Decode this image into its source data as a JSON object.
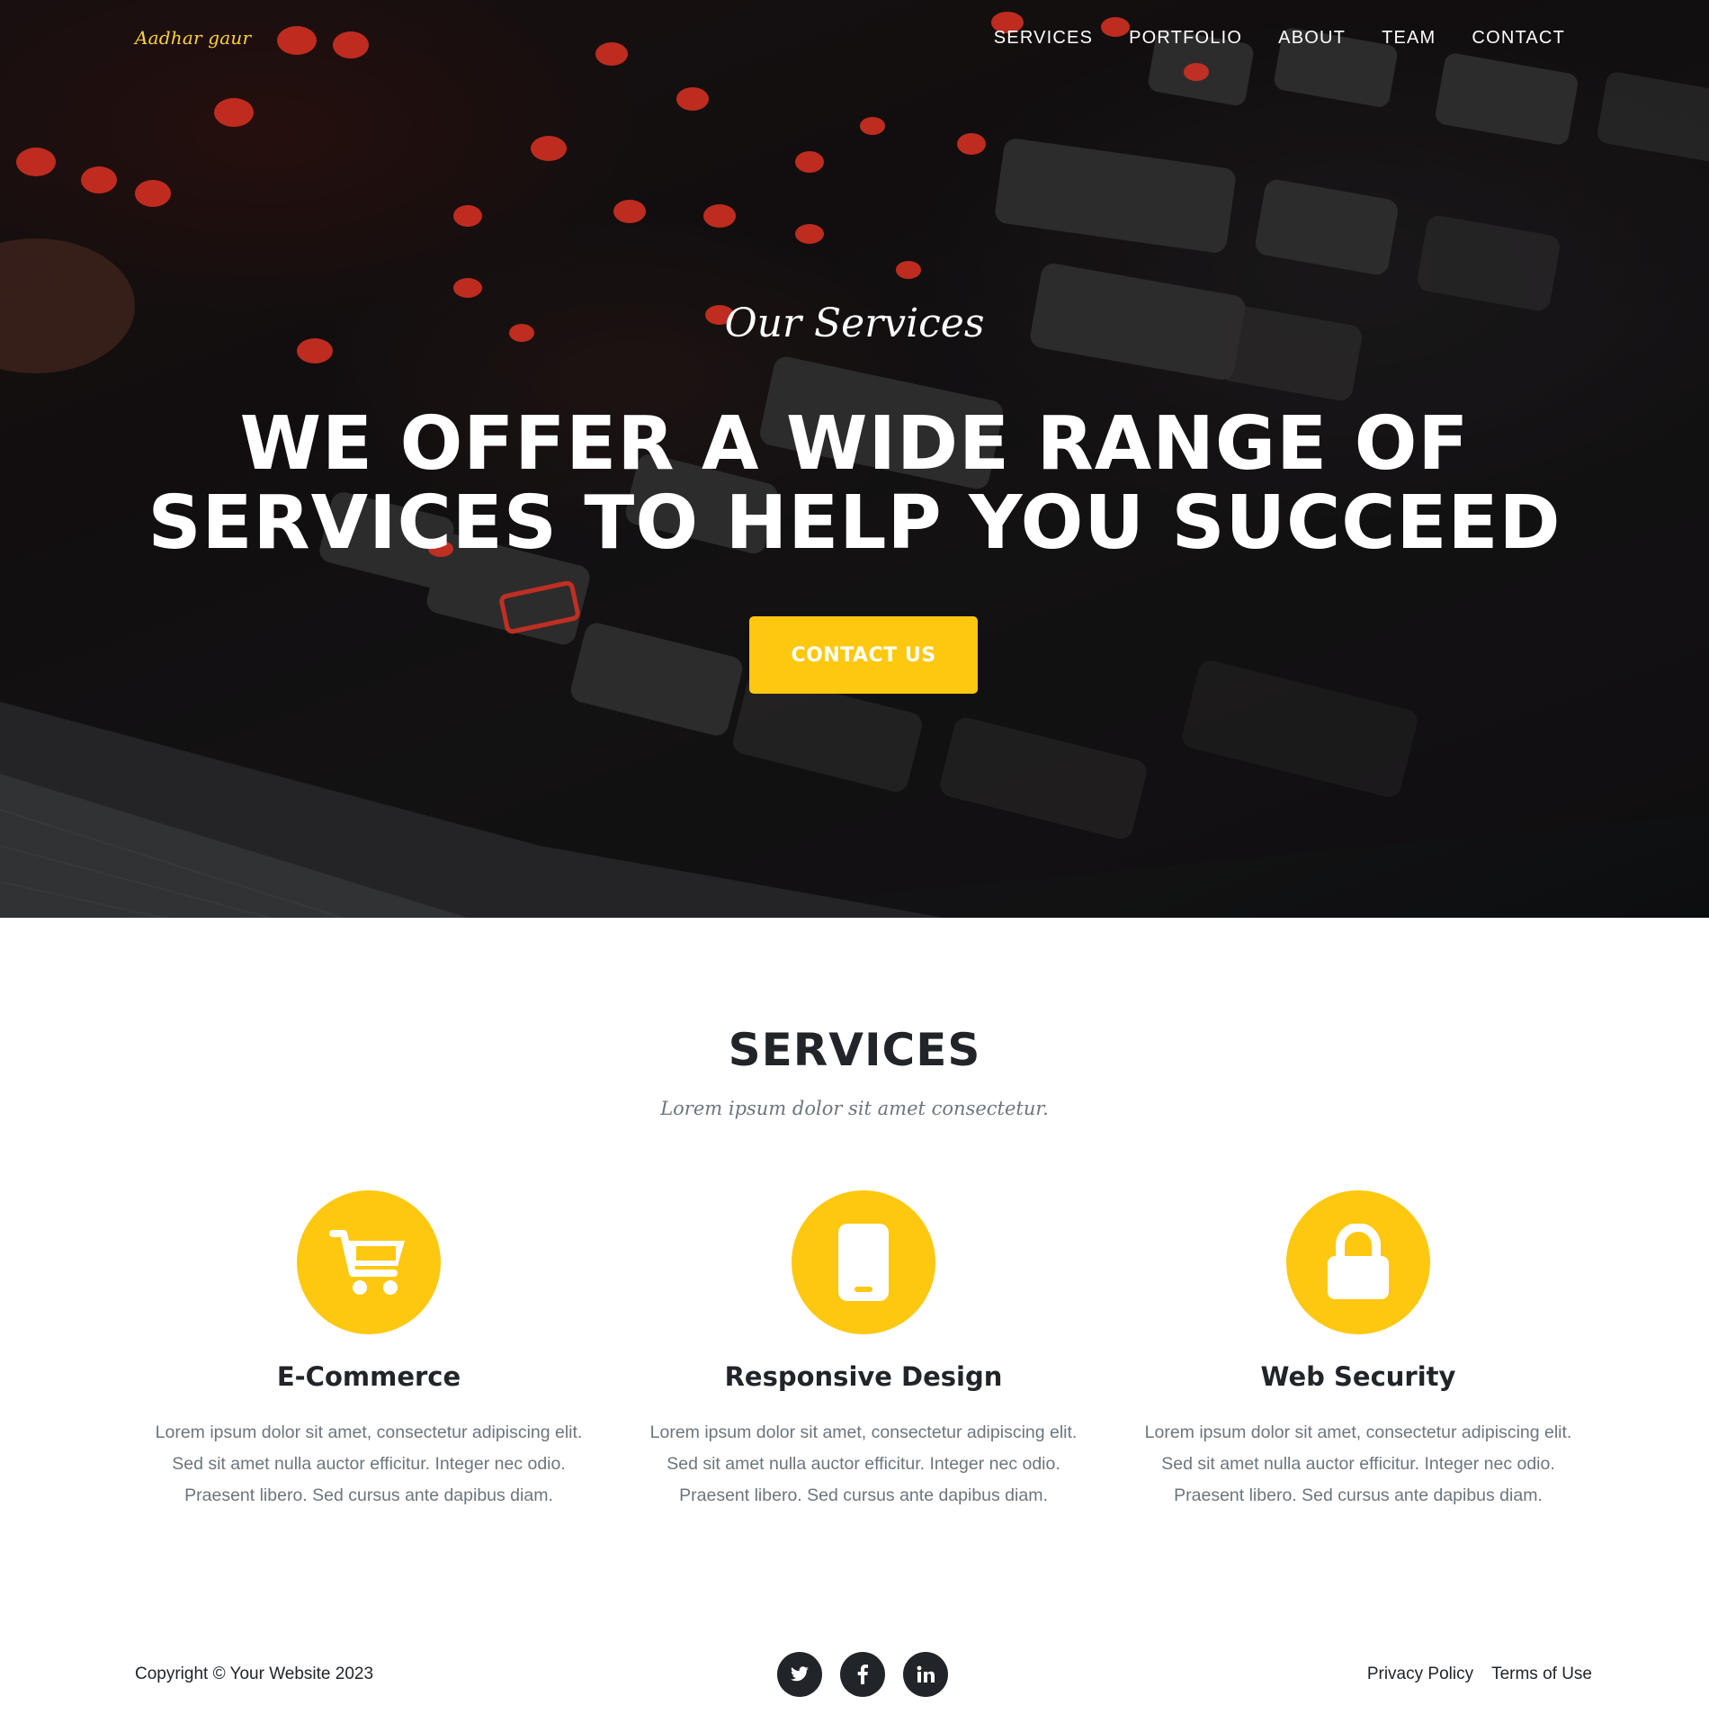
{
  "brand": {
    "name": "Aadhar gaur"
  },
  "nav": {
    "items": [
      {
        "label": "SERVICES"
      },
      {
        "label": "PORTFOLIO"
      },
      {
        "label": "ABOUT"
      },
      {
        "label": "TEAM"
      },
      {
        "label": "CONTACT"
      }
    ]
  },
  "hero": {
    "subheading": "Our Services",
    "heading": "WE OFFER A WIDE RANGE OF SERVICES TO HELP YOU SUCCEED",
    "button_label": "CONTACT US",
    "background_description": "backlit keyboard photo"
  },
  "services": {
    "heading": "SERVICES",
    "subheading": "Lorem ipsum dolor sit amet consectetur.",
    "items": [
      {
        "icon": "shopping-cart-icon",
        "title": "E-Commerce",
        "text": "Lorem ipsum dolor sit amet, consectetur adipiscing elit. Sed sit amet nulla auctor efficitur. Integer nec odio. Praesent libero. Sed cursus ante dapibus diam."
      },
      {
        "icon": "mobile-phone-icon",
        "title": "Responsive Design",
        "text": "Lorem ipsum dolor sit amet, consectetur adipiscing elit. Sed sit amet nulla auctor efficitur. Integer nec odio. Praesent libero. Sed cursus ante dapibus diam."
      },
      {
        "icon": "lock-icon",
        "title": "Web Security",
        "text": "Lorem ipsum dolor sit amet, consectetur adipiscing elit. Sed sit amet nulla auctor efficitur. Integer nec odio. Praesent libero. Sed cursus ante dapibus diam."
      }
    ]
  },
  "footer": {
    "copyright": "Copyright © Your Website 2023",
    "social": [
      "twitter-icon",
      "facebook-icon",
      "linkedin-icon"
    ],
    "privacy_label": "Privacy Policy",
    "terms_label": "Terms of Use"
  },
  "colors": {
    "accent": "#fec810",
    "dark": "#212529",
    "muted": "#6c757d"
  }
}
